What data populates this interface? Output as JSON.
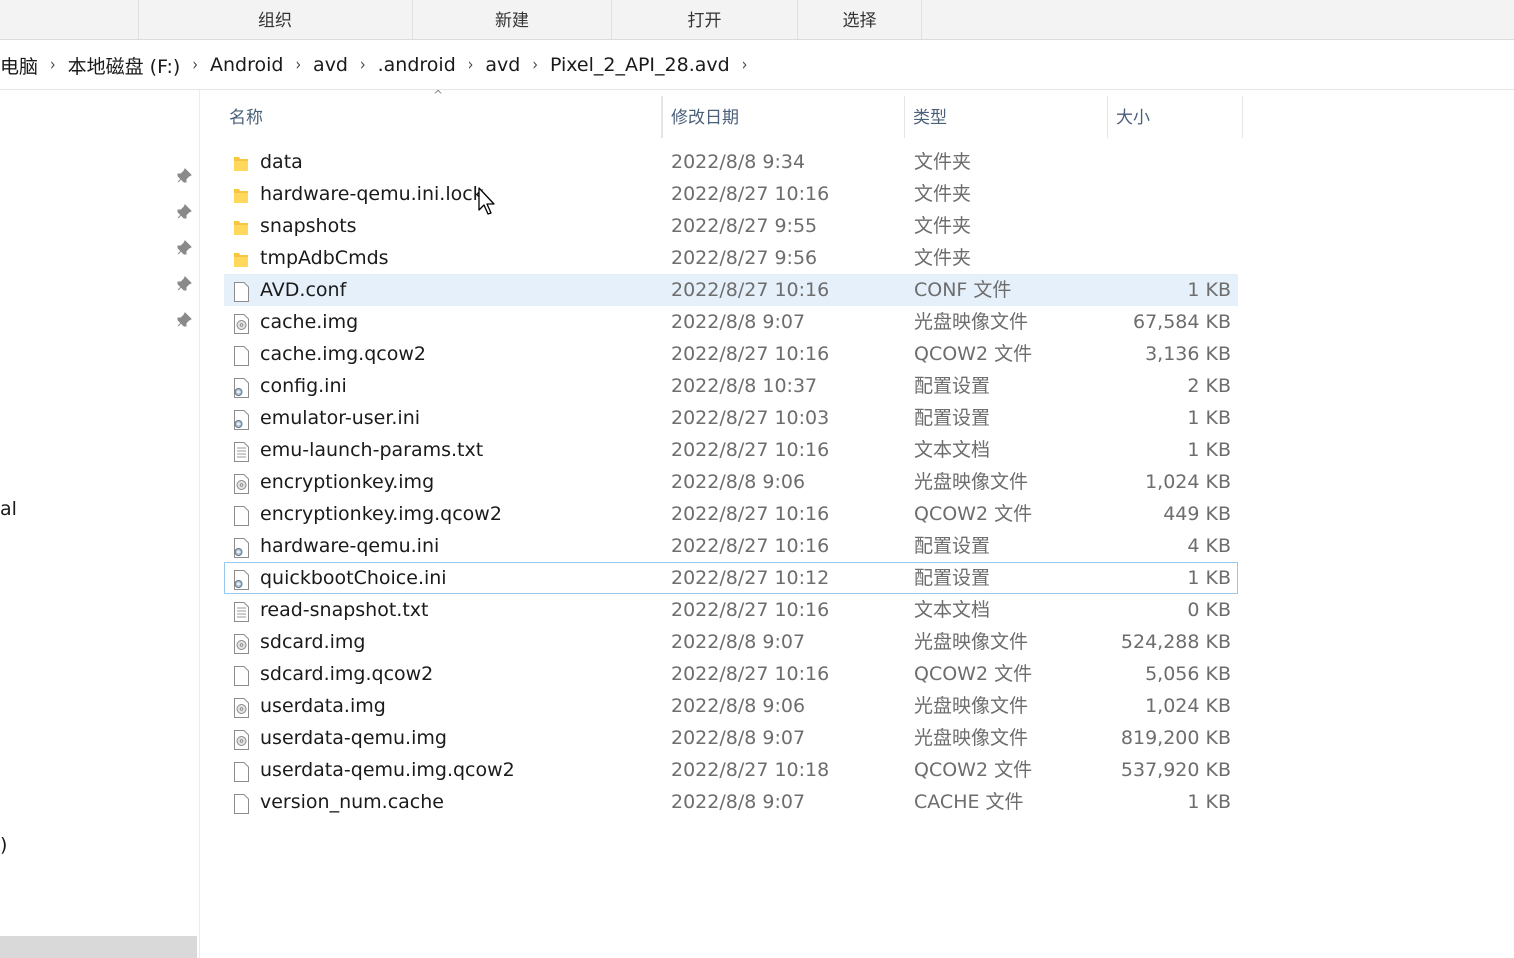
{
  "ribbon": {
    "tabs": [
      "组织",
      "新建",
      "打开",
      "选择"
    ]
  },
  "address": {
    "crumbs": [
      "电脑",
      "本地磁盘 (F:)",
      "Android",
      "avd",
      ".android",
      "avd",
      "Pixel_2_API_28.avd"
    ]
  },
  "nav": {
    "cut_text_1": "al",
    "cut_text_2": ")"
  },
  "columns": {
    "name": "名称",
    "date": "修改日期",
    "type": "类型",
    "size": "大小"
  },
  "files": [
    {
      "name": "data",
      "date": "2022/8/8 9:34",
      "type": "文件夹",
      "size": "",
      "icon": "folder-icon"
    },
    {
      "name": "hardware-qemu.ini.lock",
      "date": "2022/8/27 10:16",
      "type": "文件夹",
      "size": "",
      "icon": "folder-icon"
    },
    {
      "name": "snapshots",
      "date": "2022/8/27 9:55",
      "type": "文件夹",
      "size": "",
      "icon": "folder-icon"
    },
    {
      "name": "tmpAdbCmds",
      "date": "2022/8/27 9:56",
      "type": "文件夹",
      "size": "",
      "icon": "folder-icon"
    },
    {
      "name": "AVD.conf",
      "date": "2022/8/27 10:16",
      "type": "CONF 文件",
      "size": "1 KB",
      "icon": "file-icon"
    },
    {
      "name": "cache.img",
      "date": "2022/8/8 9:07",
      "type": "光盘映像文件",
      "size": "67,584 KB",
      "icon": "disc-image-icon"
    },
    {
      "name": "cache.img.qcow2",
      "date": "2022/8/27 10:16",
      "type": "QCOW2 文件",
      "size": "3,136 KB",
      "icon": "file-icon"
    },
    {
      "name": "config.ini",
      "date": "2022/8/8 10:37",
      "type": "配置设置",
      "size": "2 KB",
      "icon": "settings-file-icon"
    },
    {
      "name": "emulator-user.ini",
      "date": "2022/8/27 10:03",
      "type": "配置设置",
      "size": "1 KB",
      "icon": "settings-file-icon"
    },
    {
      "name": "emu-launch-params.txt",
      "date": "2022/8/27 10:16",
      "type": "文本文档",
      "size": "1 KB",
      "icon": "text-file-icon"
    },
    {
      "name": "encryptionkey.img",
      "date": "2022/8/8 9:06",
      "type": "光盘映像文件",
      "size": "1,024 KB",
      "icon": "disc-image-icon"
    },
    {
      "name": "encryptionkey.img.qcow2",
      "date": "2022/8/27 10:16",
      "type": "QCOW2 文件",
      "size": "449 KB",
      "icon": "file-icon"
    },
    {
      "name": "hardware-qemu.ini",
      "date": "2022/8/27 10:16",
      "type": "配置设置",
      "size": "4 KB",
      "icon": "settings-file-icon"
    },
    {
      "name": "quickbootChoice.ini",
      "date": "2022/8/27 10:12",
      "type": "配置设置",
      "size": "1 KB",
      "icon": "settings-file-icon"
    },
    {
      "name": "read-snapshot.txt",
      "date": "2022/8/27 10:16",
      "type": "文本文档",
      "size": "0 KB",
      "icon": "text-file-icon"
    },
    {
      "name": "sdcard.img",
      "date": "2022/8/8 9:07",
      "type": "光盘映像文件",
      "size": "524,288 KB",
      "icon": "disc-image-icon"
    },
    {
      "name": "sdcard.img.qcow2",
      "date": "2022/8/27 10:16",
      "type": "QCOW2 文件",
      "size": "5,056 KB",
      "icon": "file-icon"
    },
    {
      "name": "userdata.img",
      "date": "2022/8/8 9:06",
      "type": "光盘映像文件",
      "size": "1,024 KB",
      "icon": "disc-image-icon"
    },
    {
      "name": "userdata-qemu.img",
      "date": "2022/8/8 9:07",
      "type": "光盘映像文件",
      "size": "819,200 KB",
      "icon": "disc-image-icon"
    },
    {
      "name": "userdata-qemu.img.qcow2",
      "date": "2022/8/27 10:18",
      "type": "QCOW2 文件",
      "size": "537,920 KB",
      "icon": "file-icon"
    },
    {
      "name": "version_num.cache",
      "date": "2022/8/8 9:07",
      "type": "CACHE 文件",
      "size": "1 KB",
      "icon": "file-icon"
    }
  ],
  "selected_row": "AVD.conf",
  "focused_row": "quickbootChoice.ini",
  "colors": {
    "folder": "#f8c541",
    "selection": "#e5f0fb",
    "focus_outline": "#99c9ef",
    "header_text": "#4c607a"
  }
}
